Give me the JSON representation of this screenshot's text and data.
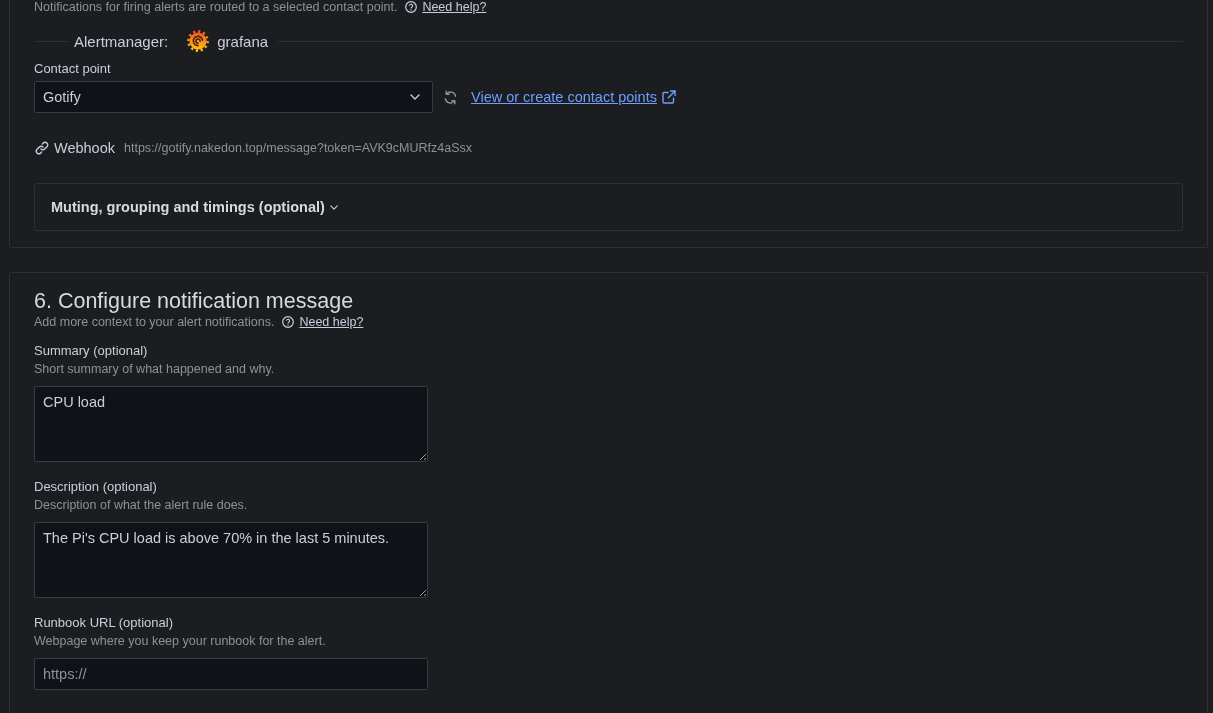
{
  "notification_section": {
    "description": "Notifications for firing alerts are routed to a selected contact point.",
    "help_link": "Need help?",
    "alertmanager": {
      "label": "Alertmanager:",
      "value": "grafana"
    },
    "contact_point": {
      "label": "Contact point",
      "value": "Gotify",
      "link": "View or create contact points"
    },
    "webhook": {
      "label": "Webhook",
      "url": "https://gotify.nakedon.top/message?token=AVK9cMURfz4aSsx"
    },
    "advanced": {
      "title": "Muting, grouping and timings (optional)",
      "expanded": false
    }
  },
  "message_section": {
    "title": "6. Configure notification message",
    "description": "Add more context to your alert notifications.",
    "help_link": "Need help?",
    "fields": [
      {
        "kind": "textarea",
        "label": "Summary (optional)",
        "hint": "Short summary of what happened and why.",
        "value": "CPU load"
      },
      {
        "kind": "textarea",
        "label": "Description (optional)",
        "hint": "Description of what the alert rule does.",
        "value": "The Pi's CPU load is above 70% in the last 5 minutes."
      },
      {
        "kind": "input",
        "label": "Runbook URL (optional)",
        "hint": "Webpage where you keep your runbook for the alert.",
        "placeholder": "https://"
      }
    ]
  }
}
